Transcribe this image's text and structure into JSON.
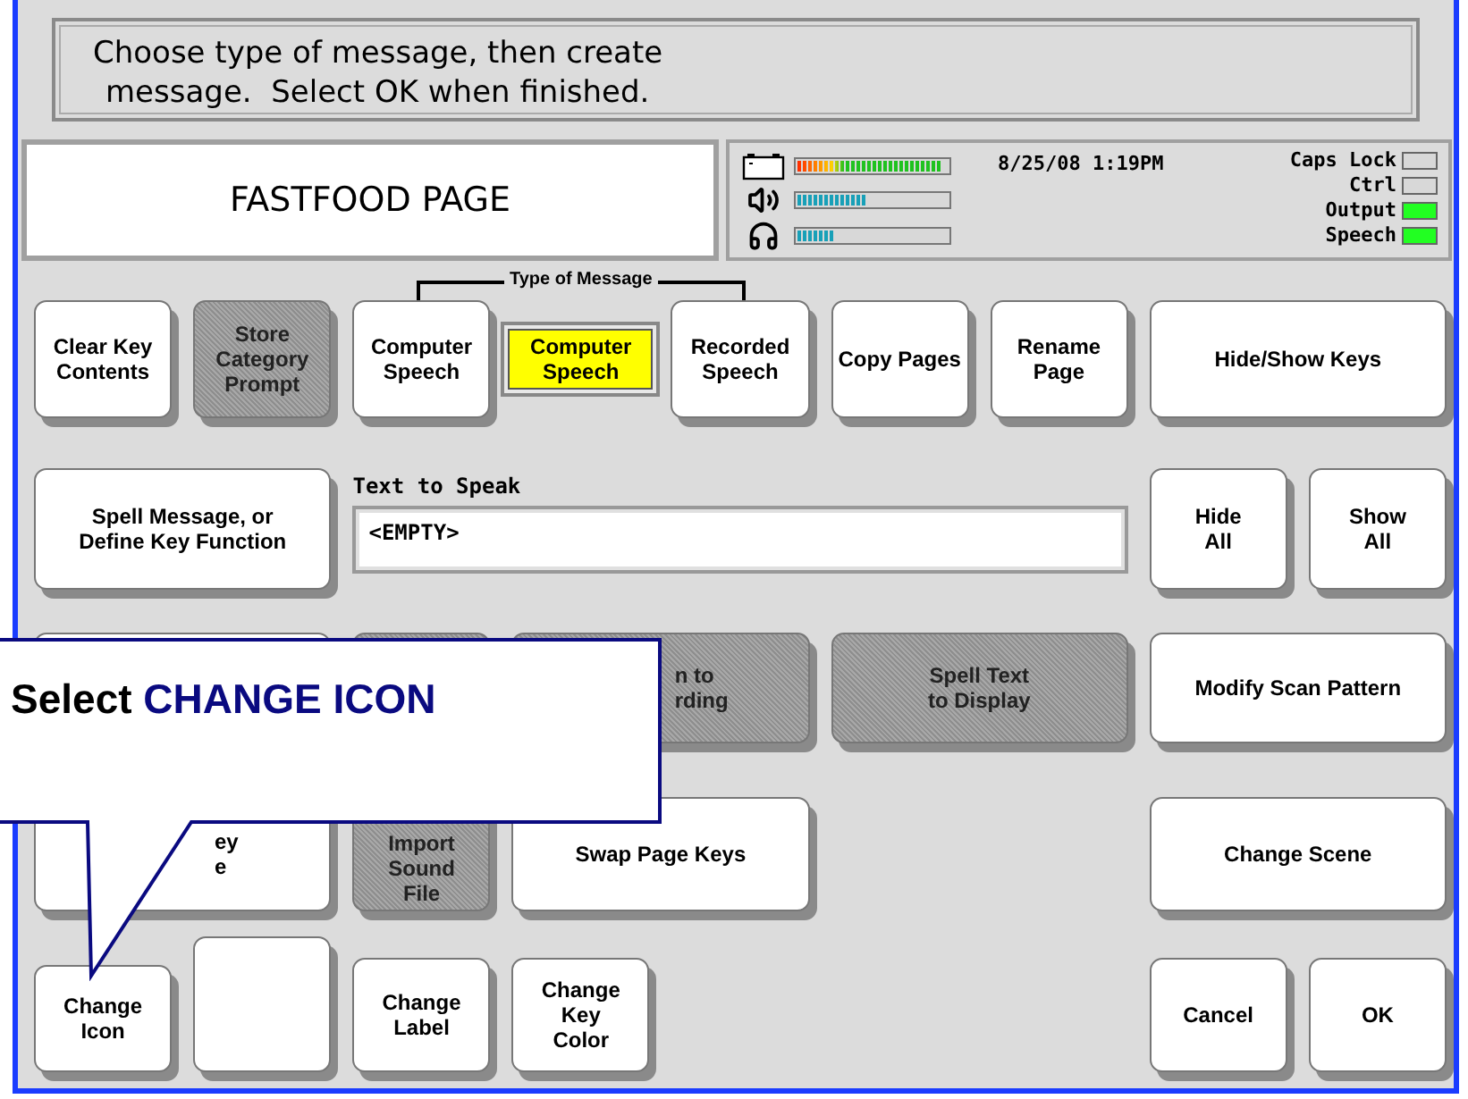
{
  "prompt": {
    "lines": [
      "Choose type of message, then create",
      "message.  Select OK when finished."
    ]
  },
  "page_name": "FASTFOOD PAGE",
  "status": {
    "meters": [
      {
        "kind": "battery",
        "level": 0.97
      },
      {
        "kind": "speaker",
        "level": 0.45
      },
      {
        "kind": "headphones",
        "level": 0.24
      }
    ],
    "datetime": "8/25/08 1:19PM",
    "indicators": [
      {
        "label": "Caps Lock",
        "on": false
      },
      {
        "label": "Ctrl",
        "on": false
      },
      {
        "label": "Output",
        "on": true
      },
      {
        "label": "Speech",
        "on": true
      }
    ]
  },
  "type_group_label": "Type of Message",
  "keys": [
    {
      "kind": "key",
      "label": "Clear Key\nContents",
      "disabled": false
    },
    {
      "kind": "key",
      "label": "Store\nCategory\nPrompt",
      "disabled": true
    },
    {
      "kind": "key",
      "label": "Computer\nSpeech",
      "disabled": false
    },
    {
      "kind": "indicator",
      "label": "Computer\nSpeech"
    },
    {
      "kind": "key",
      "label": "Recorded\nSpeech",
      "disabled": false
    },
    {
      "kind": "key",
      "label": "Copy Pages",
      "disabled": false
    },
    {
      "kind": "key",
      "label": "Rename\nPage",
      "disabled": false
    },
    {
      "kind": "key",
      "label": "Hide/Show Keys",
      "disabled": false
    },
    {
      "kind": "key",
      "label": "Spell Message, or\nDefine Key Function",
      "disabled": false
    },
    {
      "kind": "key",
      "label": "Hide\nAll",
      "disabled": false
    },
    {
      "kind": "key",
      "label": "Show\nAll",
      "disabled": false
    },
    {
      "kind": "key",
      "disabled": false
    },
    {
      "kind": "key",
      "disabled": true
    },
    {
      "kind": "key",
      "label": "n to\nrding",
      "disabled": true
    },
    {
      "kind": "key",
      "label": "Spell Text\nto Display",
      "disabled": true
    },
    {
      "kind": "key",
      "label": "Modify Scan Pattern",
      "disabled": false
    },
    {
      "kind": "key",
      "label": "ey\ne",
      "disabled": false
    },
    {
      "kind": "key",
      "label": "Import\nSound\nFile",
      "disabled": true
    },
    {
      "kind": "key",
      "label": "Swap Page Keys",
      "disabled": false
    },
    {
      "kind": "key",
      "label": "Change Scene",
      "disabled": false
    },
    {
      "kind": "key",
      "label": "Change\nIcon",
      "disabled": false
    },
    {
      "kind": "key",
      "disabled": false
    },
    {
      "kind": "key",
      "label": "Change\nLabel",
      "disabled": false
    },
    {
      "kind": "key",
      "label": "Change\nKey\nColor",
      "disabled": false
    },
    {
      "kind": "key",
      "label": "Cancel",
      "disabled": false
    },
    {
      "kind": "key",
      "label": "OK",
      "disabled": false
    }
  ],
  "text_to_speak": {
    "label": "Text to Speak",
    "value": "<EMPTY>"
  },
  "callout": {
    "prefix": "Select",
    "target": "CHANGE ICON"
  }
}
